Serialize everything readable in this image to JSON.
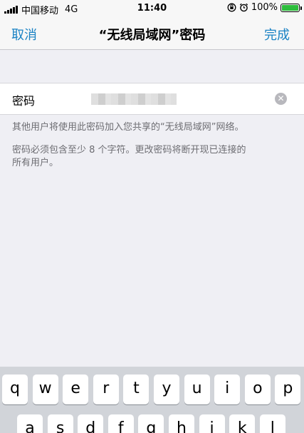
{
  "status_bar": {
    "carrier": "中国移动",
    "network": "4G",
    "time": "11:40",
    "battery_percent": "100%",
    "battery_level": 1.0,
    "icons": [
      "signal-bars-icon",
      "orientation-lock-icon",
      "alarm-icon",
      "battery-icon"
    ]
  },
  "nav": {
    "cancel": "取消",
    "title": "“无线局域网”密码",
    "done": "完成",
    "accent_color": "#1a82c4"
  },
  "password_row": {
    "label": "密码",
    "clear_icon": "clear-icon"
  },
  "notes": {
    "line1": "其他用户将使用此密码加入您共享的“无线局域网”网络。",
    "line2": "密码必须包含至少 8 个字符。更改密码将断开现已连接的",
    "line3": "所有用户。"
  },
  "keyboard": {
    "row1": [
      "q",
      "w",
      "e",
      "r",
      "t",
      "y",
      "u",
      "i",
      "o",
      "p"
    ],
    "row2": [
      "a",
      "s",
      "d",
      "f",
      "g",
      "h",
      "j",
      "k",
      "l"
    ]
  }
}
